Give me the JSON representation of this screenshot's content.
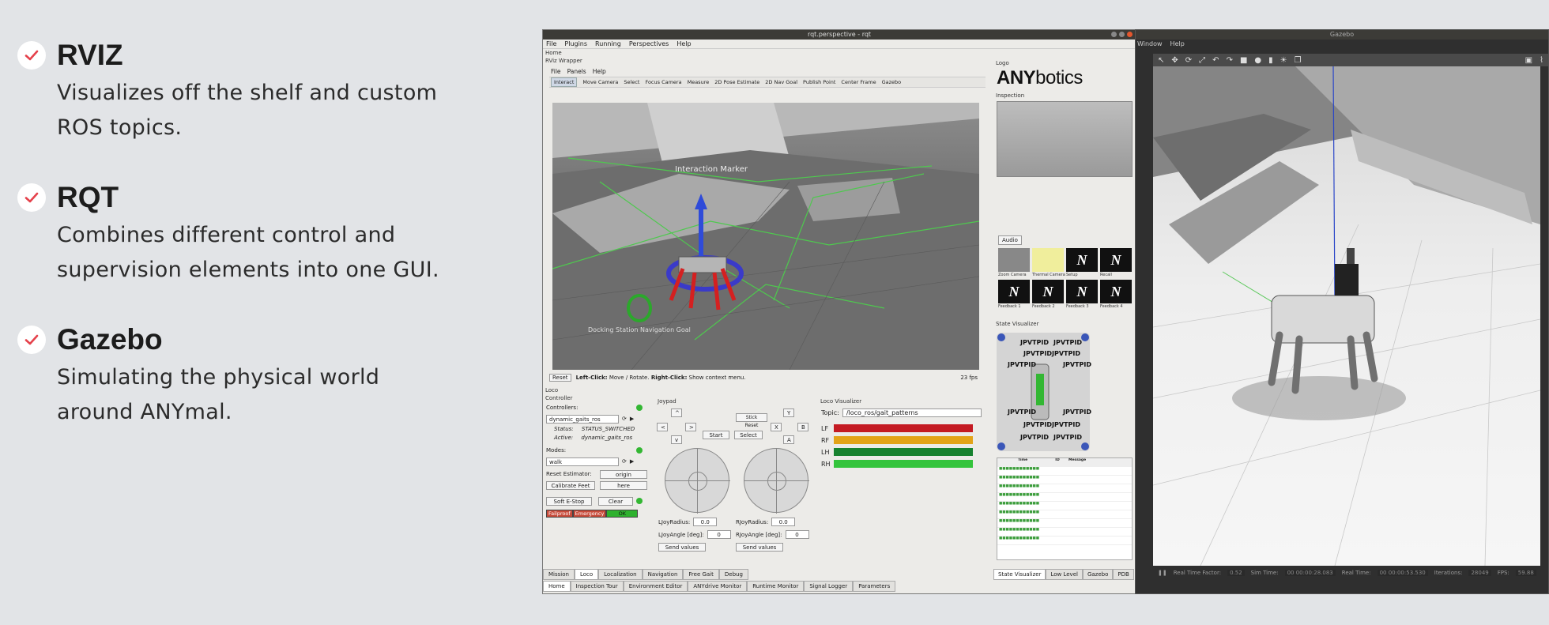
{
  "features": [
    {
      "title": "RVIZ",
      "desc_line1": "Visualizes off the shelf and custom",
      "desc_line2": "ROS topics."
    },
    {
      "title": "RQT",
      "desc_line1": "Combines different control and",
      "desc_line2": "supervision elements into one GUI."
    },
    {
      "title": "Gazebo",
      "desc_line1": "Simulating the physical world",
      "desc_line2": "around ANYmal."
    }
  ],
  "rqt": {
    "window_title": "rqt.perspective - rqt",
    "menu": [
      "File",
      "Plugins",
      "Running",
      "Perspectives",
      "Help"
    ],
    "home_label": "Home",
    "rviz_dock_title": "RViz Wrapper",
    "rviz_menu": [
      "File",
      "Panels",
      "Help"
    ],
    "rviz_tools": [
      "Interact",
      "Move Camera",
      "Select",
      "Focus Camera",
      "Measure",
      "2D Pose Estimate",
      "2D Nav Goal",
      "Publish Point",
      "Center Frame",
      "Gazebo"
    ],
    "interaction_marker_label": "Interaction  Marker",
    "docking_label": "Docking  Station  Navigation  Goal",
    "reset_label": "Reset",
    "left_click_bold": "Left-Click:",
    "left_click_text": "Move / Rotate.",
    "right_click_bold": "Right-Click:",
    "right_click_text": "Show context menu.",
    "fps": "23 fps",
    "logo_dock_title": "Logo",
    "logo_bold": "ANY",
    "logo_light": "botics",
    "inspection_title": "Inspection",
    "audio_label": "Audio",
    "thumb_labels": [
      "Zoom Camera",
      "Thermal Camera",
      "Setup",
      "Recall",
      "Feedback 1",
      "Feedback 2",
      "Feedback 3",
      "Feedback 4"
    ],
    "state_vis_title": "State Visualizer",
    "jp_label": "JPVTPID",
    "log_headers": [
      "Time",
      "ID",
      "Message"
    ],
    "right_tabs": [
      "State Visualizer",
      "Low Level",
      "Gazebo",
      "PDB"
    ],
    "loco_title": "Loco",
    "controller_title": "Controller",
    "controllers_label": "Controllers:",
    "controller_value": "dynamic_gaits_ros",
    "status_label": "Status:",
    "status_value": "STATUS_SWITCHED",
    "active_label": "Active:",
    "active_value": "dynamic_gaits_ros",
    "modes_label": "Modes:",
    "mode_value": "walk",
    "reset_estimator_label": "Reset Estimator:",
    "origin_button": "origin",
    "calibrate_button": "Calibrate Feet",
    "here_button": "here",
    "soft_estop_button": "Soft E-Stop",
    "clear_button": "Clear",
    "failproof_label": "Failproof",
    "emergency_label": "Emergency",
    "ok_label": "OK",
    "joypad_title": "Joypad",
    "stick_reset": "Stick Reset",
    "start_button": "Start",
    "select_button": "Select",
    "btn_y": "Y",
    "btn_x": "X",
    "btn_b": "B",
    "btn_a": "A",
    "arrow_up": "^",
    "arrow_left": "<",
    "arrow_right": ">",
    "arrow_down": "v",
    "ljoy_radius_label": "LJoyRadius:",
    "ljoy_radius_value": "0.0",
    "rjoy_radius_label": "RJoyRadius:",
    "rjoy_radius_value": "0.0",
    "ljoy_angle_label": "LJoyAngle [deg]:",
    "ljoy_angle_value": "0",
    "rjoy_angle_label": "RJoyAngle [deg]:",
    "rjoy_angle_value": "0",
    "send_values": "Send values",
    "loco_vis_title": "Loco Visualizer",
    "topic_label": "Topic:",
    "topic_value": "/loco_ros/gait_patterns",
    "legs": [
      {
        "name": "LF",
        "color": "#c41a22"
      },
      {
        "name": "RF",
        "color": "#e3a318"
      },
      {
        "name": "LH",
        "color": "#17822f"
      },
      {
        "name": "RH",
        "color": "#34c43c"
      }
    ],
    "loco_tabs": [
      "Mission",
      "Loco",
      "Localization",
      "Navigation",
      "Free Gait",
      "Debug"
    ],
    "home_tabs": [
      "Home",
      "Inspection Tour",
      "Environment Editor",
      "ANYdrive Monitor",
      "Runtime Monitor",
      "Signal Logger",
      "Parameters"
    ]
  },
  "gazebo": {
    "window_title": "Gazebo",
    "menu": [
      "Window",
      "Help"
    ],
    "real_time_factor_label": "Real Time Factor:",
    "real_time_factor": "0.52",
    "sim_time_label": "Sim Time:",
    "sim_time": "00 00:00:28.083",
    "real_time_label": "Real Time:",
    "real_time": "00 00:00:53.530",
    "iterations_label": "Iterations:",
    "iterations": "28049",
    "fps_label": "FPS:",
    "fps": "59.88"
  }
}
